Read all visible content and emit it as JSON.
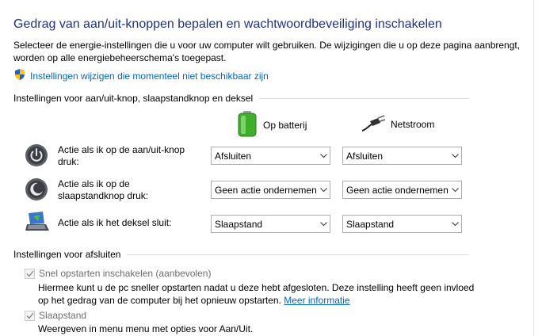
{
  "title": "Gedrag van aan/uit-knoppen bepalen en wachtwoordbeveiliging inschakelen",
  "intro": "Selecteer de energie-instellingen die u voor uw computer wilt gebruiken. De wijzigingen die u op deze pagina aanbrengt, worden op alle energiebeheerschema's toegepast.",
  "admin_link": "Instellingen wijzigen die momenteel niet beschikbaar zijn",
  "section_buttons": "Instellingen voor aan/uit-knop, slaapstandknop en deksel",
  "columns": {
    "battery": "Op batterij",
    "plugged": "Netstroom"
  },
  "rows": [
    {
      "label": "Actie als ik op de aan/uit-knop druk:",
      "battery": "Afsluiten",
      "plugged": "Afsluiten",
      "icon": "power-button-icon"
    },
    {
      "label": "Actie als ik op de slaapstandknop druk:",
      "battery": "Geen actie ondernemen",
      "plugged": "Geen actie ondernemen",
      "icon": "sleep-button-icon"
    },
    {
      "label": "Actie als ik het deksel sluit:",
      "battery": "Slaapstand",
      "plugged": "Slaapstand",
      "icon": "laptop-lid-icon"
    }
  ],
  "section_shutdown": "Instellingen voor afsluiten",
  "fast_startup": {
    "label": "Snel opstarten inschakelen (aanbevolen)",
    "checked": true,
    "desc_line1": "Hiermee kunt u de pc sneller opstarten nadat u deze hebt afgesloten. Deze instelling heeft geen invloed",
    "desc_line2": "op het gedrag van de computer bij het opnieuw opstarten.",
    "more_info": "Meer informatie"
  },
  "sleep": {
    "label": "Slaapstand",
    "checked": true,
    "desc": "Weergeven in menu menu met opties voor Aan/Uit."
  },
  "colors": {
    "title": "#1e3287",
    "link": "#0066cc",
    "disabled_text": "#6d6d6d"
  }
}
